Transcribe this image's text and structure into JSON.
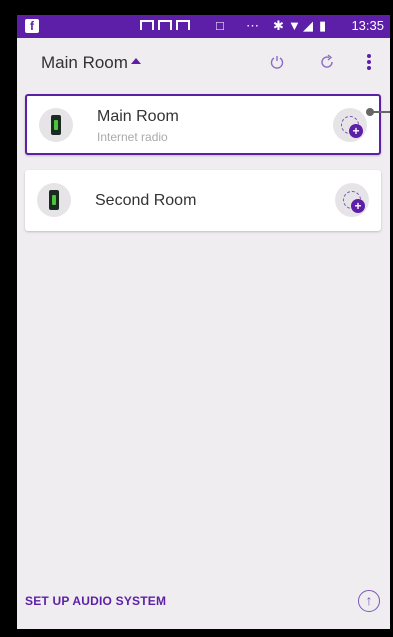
{
  "status_bar": {
    "time": "13:35",
    "icons": [
      "facebook-icon",
      "notification-icon",
      "notification-icon",
      "notification-icon",
      "cast-icon",
      "more-notifications-icon",
      "bluetooth-icon",
      "wifi-icon",
      "signal-icon",
      "battery-icon"
    ]
  },
  "app_bar": {
    "current_room": "Main Room",
    "icons": [
      "power-icon",
      "refresh-icon",
      "overflow-menu-icon"
    ]
  },
  "rooms": [
    {
      "name": "Main Room",
      "subtitle": "Internet radio",
      "active": true
    },
    {
      "name": "Second Room",
      "subtitle": "",
      "active": false
    }
  ],
  "bottom": {
    "setup_label": "SET UP AUDIO SYSTEM"
  },
  "colors": {
    "accent": "#5d1fa8",
    "background": "#efedef",
    "card": "#ffffff"
  }
}
